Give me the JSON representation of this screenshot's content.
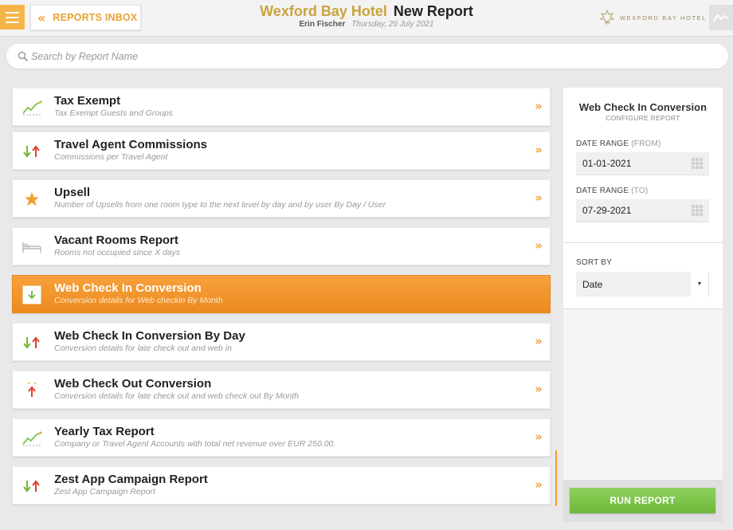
{
  "header": {
    "menu_icon": "hamburger-icon",
    "inbox_label": "REPORTS INBOX",
    "hotel_name": "Wexford Bay Hotel",
    "title": "New Report",
    "user": "Erin Fischer",
    "date": "Thursday, 29 July 2021",
    "brand_text": "WEXFORD BAY HOTEL",
    "accent": "#f0a030",
    "gold": "#c9a43c"
  },
  "search": {
    "placeholder": "Search by Report Name",
    "icon": "search-icon"
  },
  "reports": [
    {
      "name": "Tax Exempt",
      "desc": "Tax Exempt Guests and Groups",
      "icon": "trend-chart-icon"
    },
    {
      "name": "Travel Agent Commissions",
      "desc": "Commissions per Travel Agent",
      "icon": "up-down-arrows-icon"
    },
    {
      "name": "Upsell",
      "desc": "Number of Upsells from one room type to the next level by day and by user By Day / User",
      "icon": "star-icon"
    },
    {
      "name": "Vacant Rooms Report",
      "desc": "Rooms not occupied since X days",
      "icon": "bed-icon"
    },
    {
      "name": "Web Check In Conversion",
      "desc": "Conversion details for Web checkin By Month",
      "icon": "download-icon",
      "selected": true
    },
    {
      "name": "Web Check In Conversion By Day",
      "desc": "Conversion details for late check out and web in",
      "icon": "up-down-arrows-icon"
    },
    {
      "name": "Web Check Out Conversion",
      "desc": "Conversion details for late check out and web check out By Month",
      "icon": "up-arrow-icon"
    },
    {
      "name": "Yearly Tax Report",
      "desc": "Company or Travel Agent Accounts with total net revenue over EUR 250.00.",
      "icon": "trend-chart-icon"
    },
    {
      "name": "Zest App Campaign Report",
      "desc": "Zest App Campaign Report",
      "icon": "up-down-arrows-icon"
    }
  ],
  "panel": {
    "title": "Web Check In Conversion",
    "subtitle": "CONFIGURE REPORT",
    "date_from_label": "DATE RANGE",
    "date_from_hint": "(FROM)",
    "date_from_value": "01-01-2021",
    "date_to_label": "DATE RANGE",
    "date_to_hint": "(TO)",
    "date_to_value": "07-29-2021",
    "sort_label": "SORT BY",
    "sort_value": "Date",
    "run_label": "RUN REPORT",
    "run_color": "#7cc447"
  }
}
